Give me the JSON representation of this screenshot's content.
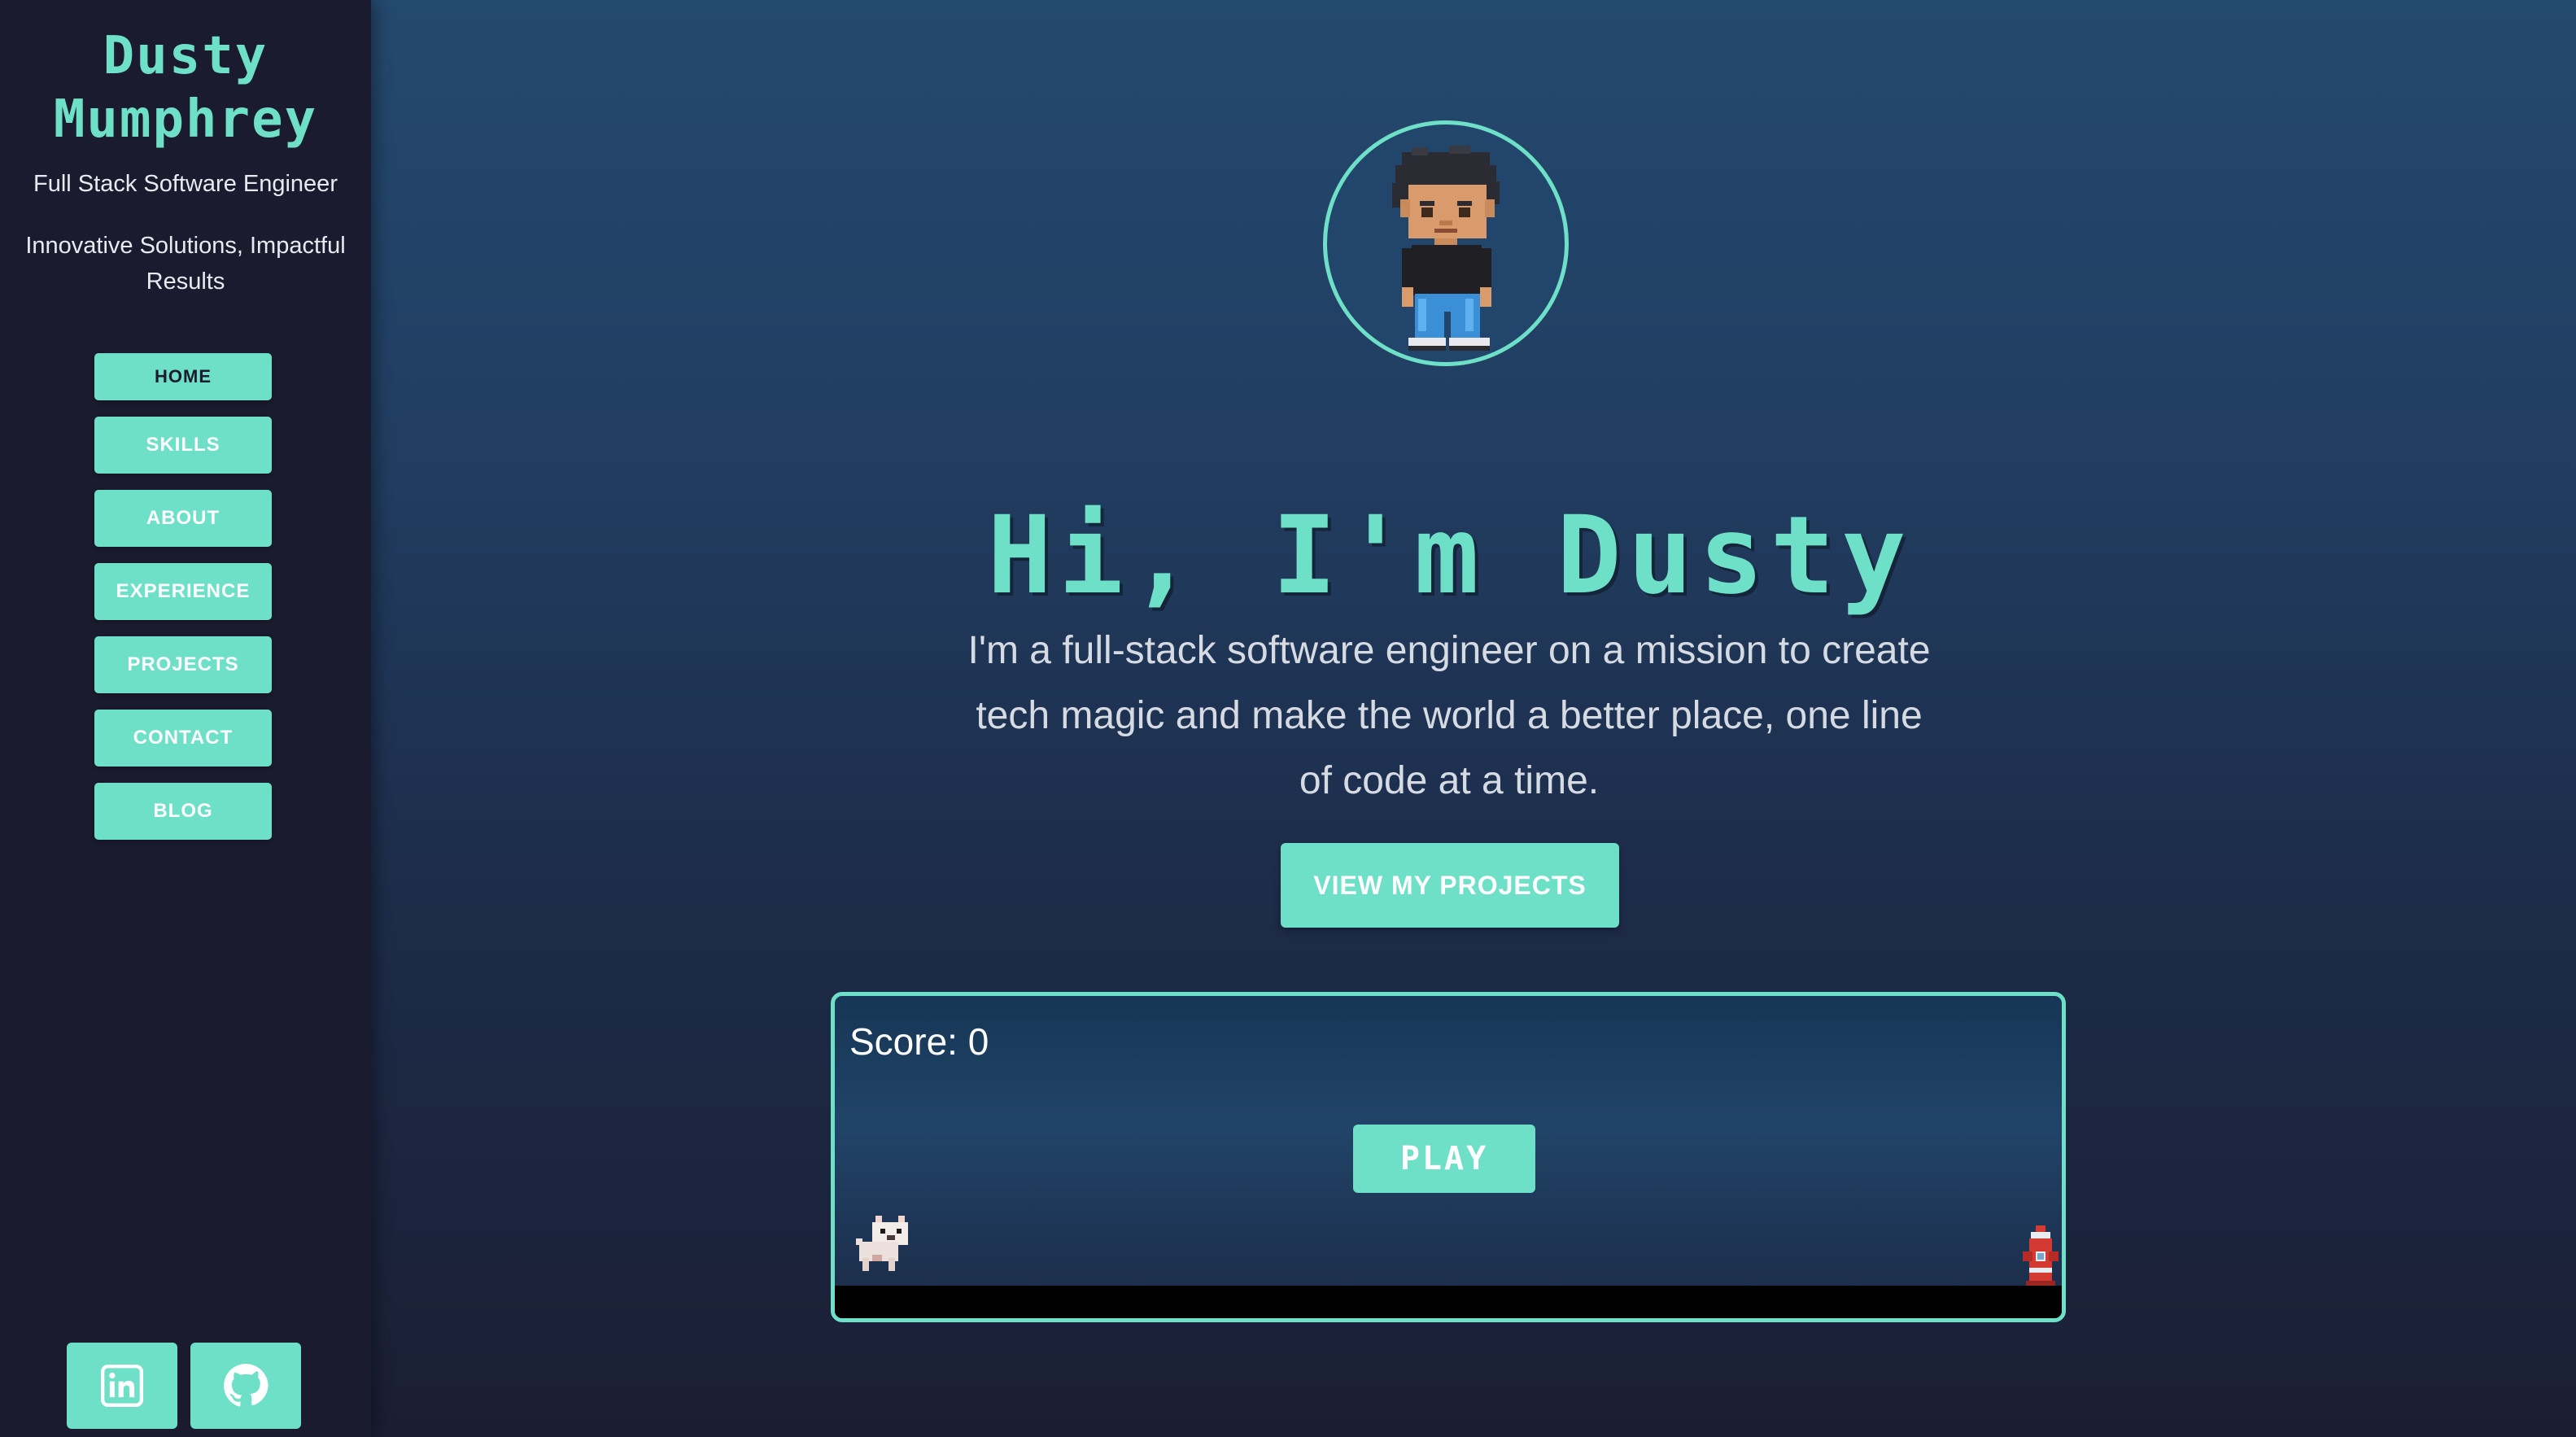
{
  "sidebar": {
    "name_line1": "Dusty",
    "name_line2": "Mumphrey",
    "role": "Full Stack Software Engineer",
    "motto": "Innovative Solutions, Impactful Results",
    "nav": [
      {
        "label": "HOME",
        "active": true
      },
      {
        "label": "SKILLS"
      },
      {
        "label": "ABOUT"
      },
      {
        "label": "EXPERIENCE"
      },
      {
        "label": "PROJECTS"
      },
      {
        "label": "CONTACT"
      },
      {
        "label": "BLOG"
      }
    ],
    "social": [
      {
        "icon": "linkedin-icon"
      },
      {
        "icon": "github-icon"
      }
    ]
  },
  "hero": {
    "avatar_icon": "pixel-character-avatar",
    "title": "Hi, I'm Dusty",
    "intro": "I'm a full-stack software engineer on a mission to create tech magic and make the world a better place, one line of code at a time.",
    "cta_label": "VIEW MY PROJECTS"
  },
  "game": {
    "score_label": "Score:",
    "score_value": "0",
    "play_label": "PLAY",
    "player_icon": "pixel-dog-icon",
    "obstacle_icon": "fire-hydrant-icon"
  },
  "colors": {
    "accent": "#6ee0c8",
    "sidebar_bg": "#1a1b2e",
    "main_bg_top": "#24496e",
    "main_bg_bottom": "#1a1e33"
  }
}
